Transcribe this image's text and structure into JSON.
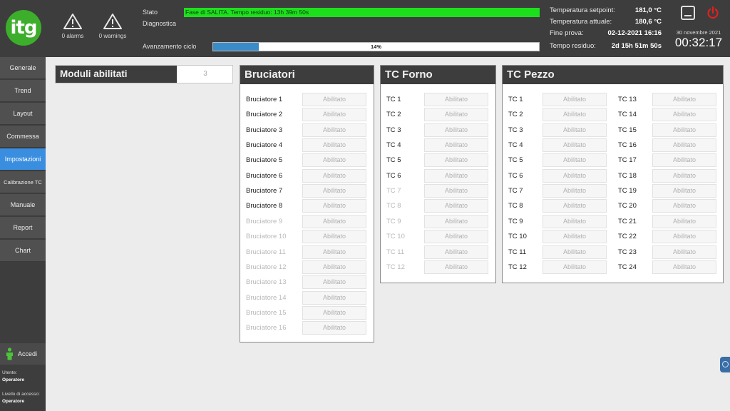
{
  "header": {
    "logo_text": "itg",
    "alarms": "0 alarms",
    "warnings": "0 warnings",
    "stato_label": "Stato",
    "diagnostica_label": "Diagnostica",
    "stato_value": "Fase di SALITA. Tempo residuo: 13h 39m 50s",
    "stato_color": "#1de01d",
    "avanzamento_label": "Avanzamento ciclo",
    "progress_percent": 14,
    "progress_text": "14%",
    "info": [
      {
        "label": "Temperatura setpoint:",
        "value": "181,0 °C"
      },
      {
        "label": "Temperatura attuale:",
        "value": "180,6 °C"
      },
      {
        "label": "Fine prova:",
        "value": "02-12-2021 16:16"
      },
      {
        "label": "Tempo residuo:",
        "value": "2d 15h 51m 50s"
      }
    ],
    "date": "30 novembre 2021",
    "time": "00:32:17"
  },
  "sidebar": {
    "items": [
      {
        "label": "Generale"
      },
      {
        "label": "Trend"
      },
      {
        "label": "Layout"
      },
      {
        "label": "Commessa"
      },
      {
        "label": "Impostazioni",
        "active": true
      },
      {
        "label": "Calibrazione TC"
      },
      {
        "label": "Manuale"
      },
      {
        "label": "Report"
      },
      {
        "label": "Chart"
      }
    ],
    "login_label": "Accedi",
    "user_label": "Utente:",
    "user_value": "Operatore",
    "level_label": "Livello di accesso:",
    "level_value": "Operatore"
  },
  "moduli": {
    "label": "Moduli abilitati",
    "value": "3"
  },
  "bruciatori": {
    "title": "Bruciatori",
    "value_text": "Abilitato",
    "rows": [
      {
        "label": "Bruciatore 1",
        "enabled": true
      },
      {
        "label": "Bruciatore 2",
        "enabled": true
      },
      {
        "label": "Bruciatore 3",
        "enabled": true
      },
      {
        "label": "Bruciatore 4",
        "enabled": true
      },
      {
        "label": "Bruciatore 5",
        "enabled": true
      },
      {
        "label": "Bruciatore 6",
        "enabled": true
      },
      {
        "label": "Bruciatore 7",
        "enabled": true
      },
      {
        "label": "Bruciatore 8",
        "enabled": true
      },
      {
        "label": "Bruciatore 9",
        "enabled": false
      },
      {
        "label": "Bruciatore 10",
        "enabled": false
      },
      {
        "label": "Bruciatore 11",
        "enabled": false
      },
      {
        "label": "Bruciatore 12",
        "enabled": false
      },
      {
        "label": "Bruciatore 13",
        "enabled": false
      },
      {
        "label": "Bruciatore 14",
        "enabled": false
      },
      {
        "label": "Bruciatore 15",
        "enabled": false
      },
      {
        "label": "Bruciatore 16",
        "enabled": false
      }
    ]
  },
  "tc_forno": {
    "title": "TC Forno",
    "value_text": "Abilitato",
    "rows": [
      {
        "label": "TC 1",
        "enabled": true
      },
      {
        "label": "TC 2",
        "enabled": true
      },
      {
        "label": "TC 3",
        "enabled": true
      },
      {
        "label": "TC 4",
        "enabled": true
      },
      {
        "label": "TC 5",
        "enabled": true
      },
      {
        "label": "TC 6",
        "enabled": true
      },
      {
        "label": "TC 7",
        "enabled": false
      },
      {
        "label": "TC 8",
        "enabled": false
      },
      {
        "label": "TC 9",
        "enabled": false
      },
      {
        "label": "TC 10",
        "enabled": false
      },
      {
        "label": "TC 11",
        "enabled": false
      },
      {
        "label": "TC 12",
        "enabled": false
      }
    ]
  },
  "tc_pezzo": {
    "title": "TC Pezzo",
    "value_text": "Abilitato",
    "rows_left": [
      {
        "label": "TC 1",
        "enabled": true
      },
      {
        "label": "TC 2",
        "enabled": true
      },
      {
        "label": "TC 3",
        "enabled": true
      },
      {
        "label": "TC 4",
        "enabled": true
      },
      {
        "label": "TC 5",
        "enabled": true
      },
      {
        "label": "TC 6",
        "enabled": true
      },
      {
        "label": "TC 7",
        "enabled": true
      },
      {
        "label": "TC 8",
        "enabled": true
      },
      {
        "label": "TC 9",
        "enabled": true
      },
      {
        "label": "TC 10",
        "enabled": true
      },
      {
        "label": "TC 11",
        "enabled": true
      },
      {
        "label": "TC 12",
        "enabled": true
      }
    ],
    "rows_right": [
      {
        "label": "TC 13",
        "enabled": true
      },
      {
        "label": "TC 14",
        "enabled": true
      },
      {
        "label": "TC 15",
        "enabled": true
      },
      {
        "label": "TC 16",
        "enabled": true
      },
      {
        "label": "TC 17",
        "enabled": true
      },
      {
        "label": "TC 18",
        "enabled": true
      },
      {
        "label": "TC 19",
        "enabled": true
      },
      {
        "label": "TC 20",
        "enabled": true
      },
      {
        "label": "TC 21",
        "enabled": true
      },
      {
        "label": "TC 22",
        "enabled": true
      },
      {
        "label": "TC 23",
        "enabled": true
      },
      {
        "label": "TC 24",
        "enabled": true
      }
    ]
  }
}
